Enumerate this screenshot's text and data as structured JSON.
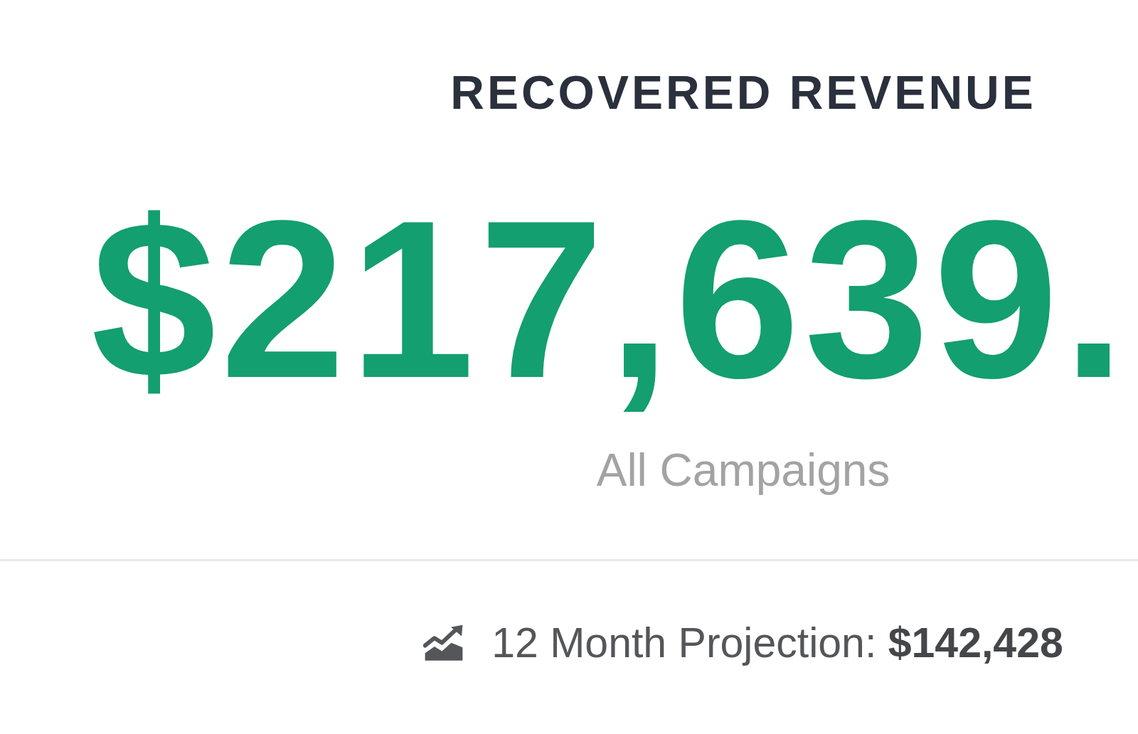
{
  "metric": {
    "title": "RECOVERED REVENUE",
    "value": "$217,639.",
    "subtitle": "All Campaigns"
  },
  "projection": {
    "label": "12 Month Projection:",
    "value": "$142,428"
  }
}
